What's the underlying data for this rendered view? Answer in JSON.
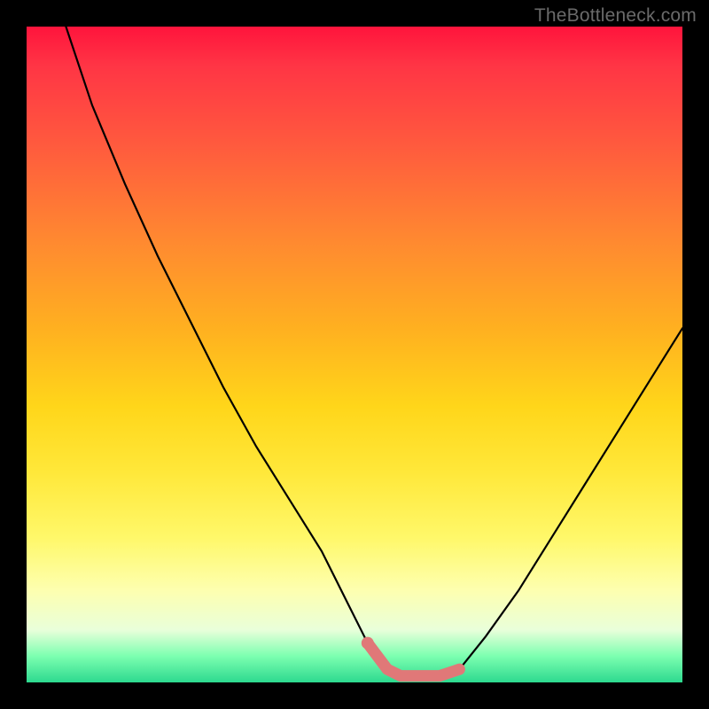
{
  "watermark": "TheBottleneck.com",
  "chart_data": {
    "type": "line",
    "title": "",
    "xlabel": "",
    "ylabel": "",
    "xlim": [
      0,
      100
    ],
    "ylim": [
      0,
      100
    ],
    "series": [
      {
        "name": "bottleneck-curve",
        "x": [
          6,
          10,
          15,
          20,
          25,
          30,
          35,
          40,
          45,
          49,
          52,
          55,
          57,
          60,
          63,
          66,
          70,
          75,
          80,
          85,
          90,
          95,
          100
        ],
        "y": [
          100,
          88,
          76,
          65,
          55,
          45,
          36,
          28,
          20,
          12,
          6,
          2,
          1,
          1,
          1,
          2,
          7,
          14,
          22,
          30,
          38,
          46,
          54
        ]
      }
    ],
    "highlight": {
      "name": "optimum-band",
      "x": [
        52,
        55,
        57,
        60,
        63,
        66
      ],
      "y": [
        6,
        2,
        1,
        1,
        1,
        2
      ],
      "color": "#e07878"
    },
    "gradient_stops": [
      {
        "pct": 0,
        "color": "#ff143c"
      },
      {
        "pct": 18,
        "color": "#ff5a3e"
      },
      {
        "pct": 46,
        "color": "#ffb020"
      },
      {
        "pct": 78,
        "color": "#fff86a"
      },
      {
        "pct": 100,
        "color": "#2dd98f"
      }
    ]
  }
}
